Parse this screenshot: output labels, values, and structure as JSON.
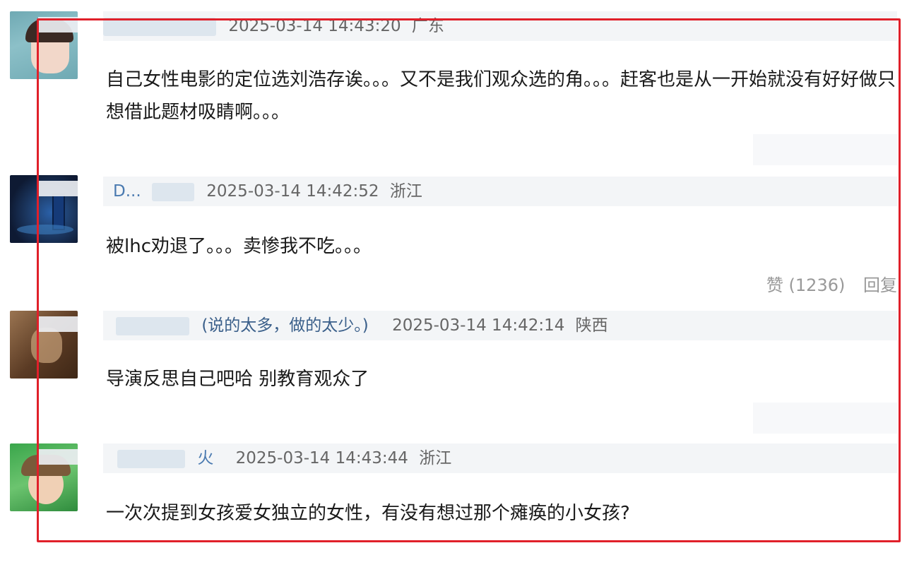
{
  "comments": [
    {
      "name_tail": "",
      "note": "",
      "time": "2025-03-14 14:43:20",
      "location": "广东",
      "text": "自己女性电影的定位选刘浩存诶。。。又不是我们观众选的角。。。赶客也是从一开始就没有好好做只想借此题材吸睛啊。。。",
      "avatar_colors": [
        "#6fa9b3",
        "#f2d7c9",
        "#3b2a24"
      ]
    },
    {
      "name_tail": "D...",
      "note": "",
      "time": "2025-03-14 14:42:52",
      "location": "浙江",
      "text": "被lhc劝退了。。。卖惨我不吃。。。",
      "avatar_colors": [
        "#0e1a33",
        "#1f3f6d",
        "#2a60a8"
      ],
      "likes_label": "赞 (1236)",
      "reply_label": "回复"
    },
    {
      "name_tail": "",
      "note": "(说的太多，做的太少。)",
      "time": "2025-03-14 14:42:14",
      "location": "陕西",
      "text": "导演反思自己吧哈 别教育观众了",
      "avatar_colors": [
        "#5b3b24",
        "#9a7451",
        "#c9a27a"
      ]
    },
    {
      "name_tail": "火",
      "note": "",
      "time": "2025-03-14 14:43:44",
      "location": "浙江",
      "text": "一次次提到女孩爱女独立的女性，有没有想过那个瘫痪的小女孩?",
      "avatar_colors": [
        "#3aa64b",
        "#f0d0b5",
        "#7a5a3a"
      ]
    }
  ],
  "highlight_color": "#e0202a"
}
